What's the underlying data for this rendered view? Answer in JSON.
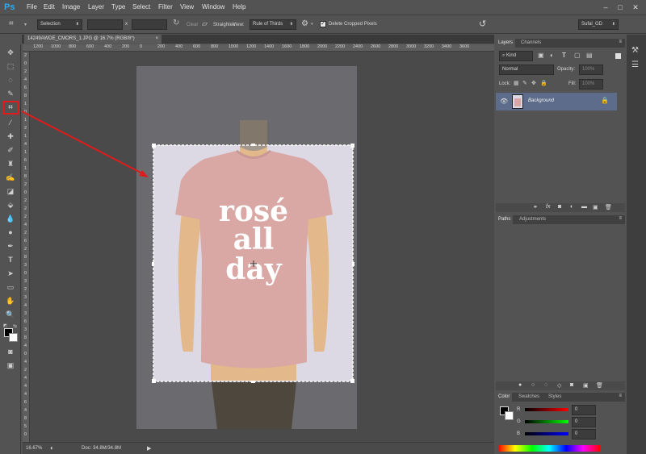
{
  "app": {
    "logo": "Ps"
  },
  "menu": [
    "File",
    "Edit",
    "Image",
    "Layer",
    "Type",
    "Select",
    "Filter",
    "View",
    "Window",
    "Help"
  ],
  "window_controls": {
    "minimize": "–",
    "maximize": "□",
    "close": "✕"
  },
  "options": {
    "preset": "Selection",
    "ratio_separator": "x",
    "clear_label": "Clear",
    "straighten_label": "Straighten",
    "view_label": "View:",
    "view_value": "Rule of Thirds",
    "delete_cropped_label": "Delete Cropped Pixels",
    "delete_cropped_checked": true,
    "workspace": "Sufal_GD"
  },
  "document": {
    "tab_title": "14249AWDE_CMORS_1.JPG @ 16.7% (RGB/8*)",
    "tab_close": "×",
    "shirt_text": [
      "rosé",
      "all",
      "day"
    ]
  },
  "ruler_h": [
    "1200",
    "1000",
    "800",
    "600",
    "400",
    "200",
    "0",
    "200",
    "400",
    "600",
    "800",
    "1000",
    "1200",
    "1400",
    "1600",
    "1800",
    "2000",
    "2200",
    "2400",
    "2600",
    "2800",
    "3000",
    "3200",
    "3400",
    "3600"
  ],
  "ruler_v": [
    "2",
    "0",
    "2",
    "4",
    "6",
    "8",
    "1",
    "0",
    "1",
    "2",
    "1",
    "4",
    "1",
    "6",
    "1",
    "8",
    "2",
    "0",
    "2",
    "2",
    "2",
    "4",
    "2",
    "6",
    "2",
    "8",
    "3",
    "0",
    "3",
    "2",
    "3",
    "4",
    "3",
    "6",
    "3",
    "8",
    "4",
    "0",
    "4",
    "2",
    "4",
    "4",
    "4",
    "6",
    "4",
    "8",
    "5",
    "0"
  ],
  "status": {
    "zoom": "16.67%",
    "doc": "Doc: 34.8M/34.8M"
  },
  "layers_panel": {
    "tabs": [
      "Layers",
      "Channels"
    ],
    "kind_label": "Kind",
    "blend_mode": "Normal",
    "opacity_label": "Opacity:",
    "opacity_value": "100%",
    "lock_label": "Lock:",
    "fill_label": "Fill:",
    "fill_value": "100%",
    "layer_name": "Background"
  },
  "paths_panel": {
    "tabs": [
      "Paths",
      "Adjustments"
    ]
  },
  "color_panel": {
    "tabs": [
      "Color",
      "Swatches",
      "Styles"
    ],
    "channels": [
      {
        "label": "R",
        "value": "0"
      },
      {
        "label": "G",
        "value": "0"
      },
      {
        "label": "B",
        "value": "0"
      }
    ]
  },
  "colors": {
    "accent": "#e01b1b",
    "layer_selected": "#5c6c8a",
    "shirt": "#d9a8a4",
    "mannequin": "#e3b88a"
  }
}
